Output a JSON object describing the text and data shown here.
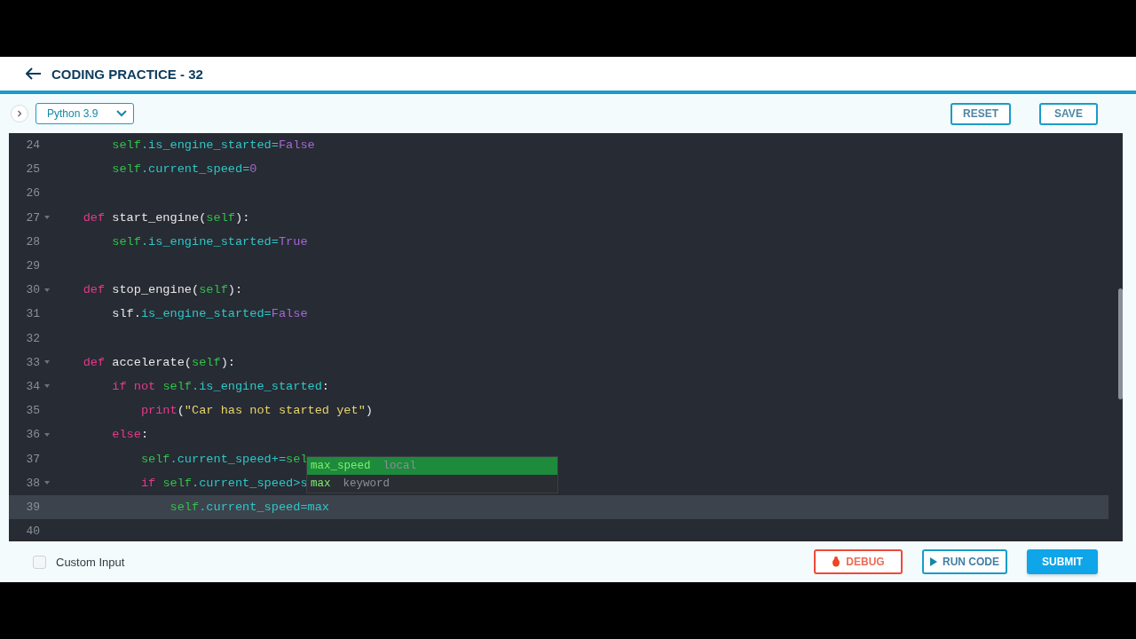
{
  "header": {
    "title": "CODING PRACTICE - 32"
  },
  "toolbar": {
    "language": "Python 3.9",
    "buttons": [
      "RESET",
      "SAVE"
    ]
  },
  "editor": {
    "lines": [
      {
        "number": "24",
        "fold": false,
        "active": false,
        "tokens": [
          {
            "text": "        self",
            "kind": "self"
          },
          {
            "text": ".is_engine_started",
            "kind": "attr"
          },
          {
            "text": "=",
            "kind": "attr"
          },
          {
            "text": "False",
            "kind": "const"
          }
        ]
      },
      {
        "number": "25",
        "fold": false,
        "active": false,
        "tokens": [
          {
            "text": "        self",
            "kind": "self"
          },
          {
            "text": ".current_speed",
            "kind": "attr"
          },
          {
            "text": "=",
            "kind": "attr"
          },
          {
            "text": "0",
            "kind": "const"
          }
        ]
      },
      {
        "number": "26",
        "fold": false,
        "active": false
      },
      {
        "number": "27",
        "fold": true,
        "active": false,
        "tokens": [
          {
            "text": "    def",
            "kind": "kw"
          },
          {
            "text": " start_engine(",
            "kind": "plain"
          },
          {
            "text": "self",
            "kind": "self"
          },
          {
            "text": "):",
            "kind": "plain"
          }
        ]
      },
      {
        "number": "28",
        "fold": false,
        "active": false,
        "tokens": [
          {
            "text": "        self",
            "kind": "self"
          },
          {
            "text": ".is_engine_started",
            "kind": "attr"
          },
          {
            "text": "=",
            "kind": "attr"
          },
          {
            "text": "True",
            "kind": "const"
          }
        ]
      },
      {
        "number": "29",
        "fold": false,
        "active": false
      },
      {
        "number": "30",
        "fold": true,
        "active": false,
        "tokens": [
          {
            "text": "    def",
            "kind": "kw"
          },
          {
            "text": " stop_engine(",
            "kind": "plain"
          },
          {
            "text": "self",
            "kind": "self"
          },
          {
            "text": "):",
            "kind": "plain"
          }
        ]
      },
      {
        "number": "31",
        "fold": false,
        "active": false,
        "tokens": [
          {
            "text": "        slf.",
            "kind": "plain"
          },
          {
            "text": "is_engine_started",
            "kind": "attr"
          },
          {
            "text": "=",
            "kind": "attr"
          },
          {
            "text": "False",
            "kind": "const"
          }
        ]
      },
      {
        "number": "32",
        "fold": false,
        "active": false
      },
      {
        "number": "33",
        "fold": true,
        "active": false,
        "tokens": [
          {
            "text": "    def",
            "kind": "kw"
          },
          {
            "text": " accelerate(",
            "kind": "plain"
          },
          {
            "text": "self",
            "kind": "self"
          },
          {
            "text": "):",
            "kind": "plain"
          }
        ]
      },
      {
        "number": "34",
        "fold": true,
        "active": false,
        "tokens": [
          {
            "text": "        if not",
            "kind": "kw"
          },
          {
            "text": " self",
            "kind": "self"
          },
          {
            "text": ".is_engine_started",
            "kind": "attr"
          },
          {
            "text": ":",
            "kind": "plain"
          }
        ]
      },
      {
        "number": "35",
        "fold": false,
        "active": false,
        "tokens": [
          {
            "text": "            print",
            "kind": "kw"
          },
          {
            "text": "(",
            "kind": "plain"
          },
          {
            "text": "\"Car has not started yet\"",
            "kind": "str"
          },
          {
            "text": ")",
            "kind": "plain"
          }
        ]
      },
      {
        "number": "36",
        "fold": true,
        "active": false,
        "tokens": [
          {
            "text": "        else",
            "kind": "kw"
          },
          {
            "text": ":",
            "kind": "plain"
          }
        ]
      },
      {
        "number": "37",
        "fold": false,
        "active": false,
        "tokens": [
          {
            "text": "            self",
            "kind": "self"
          },
          {
            "text": ".current_speed",
            "kind": "attr"
          },
          {
            "text": "+=",
            "kind": "attr"
          },
          {
            "text": "sel",
            "kind": "self"
          }
        ]
      },
      {
        "number": "38",
        "fold": true,
        "active": false,
        "tokens": [
          {
            "text": "            if",
            "kind": "kw"
          },
          {
            "text": " self",
            "kind": "self"
          },
          {
            "text": ".current_speed",
            "kind": "attr"
          },
          {
            "text": ">s",
            "kind": "attr"
          }
        ]
      },
      {
        "number": "39",
        "fold": false,
        "active": true,
        "tokens": [
          {
            "text": "                self",
            "kind": "self"
          },
          {
            "text": ".current_speed",
            "kind": "attr"
          },
          {
            "text": "=",
            "kind": "attr"
          },
          {
            "text": "max",
            "kind": "attr"
          }
        ]
      },
      {
        "number": "40",
        "fold": false,
        "active": false
      }
    ],
    "autocomplete": [
      {
        "label": "max_speed",
        "type": "local",
        "selected": true
      },
      {
        "label": "max",
        "type": "keyword",
        "selected": false
      }
    ]
  },
  "footer": {
    "custom_input": {
      "label": "Custom Input",
      "checked": false
    },
    "buttons": [
      {
        "kind": "debug",
        "label": "DEBUG"
      },
      {
        "kind": "run",
        "label": "RUN CODE"
      },
      {
        "kind": "submit",
        "label": "SUBMIT"
      }
    ]
  }
}
